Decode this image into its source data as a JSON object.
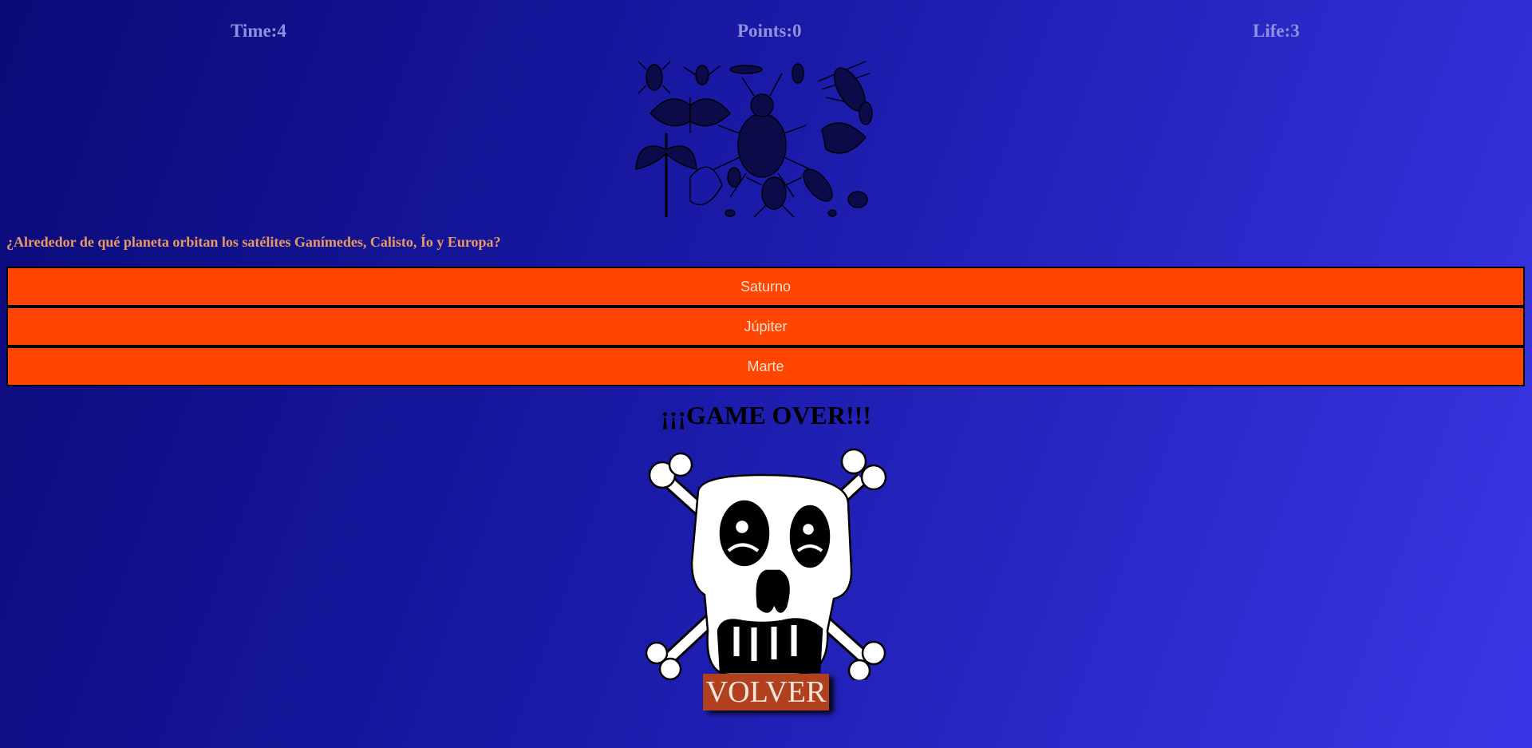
{
  "hud": {
    "time": "Time:4",
    "points": "Points:0",
    "life": "Life:3"
  },
  "question": "¿Alrededor de qué planeta orbitan los satélites Ganímedes, Calisto, Ío y Europa?",
  "answers": [
    {
      "label": "Saturno"
    },
    {
      "label": "Júpiter"
    },
    {
      "label": "Marte"
    }
  ],
  "game_over": "¡¡¡GAME OVER!!!",
  "volver_button": "VOLVER",
  "colors": {
    "answer_bg": "#ff4500",
    "question_text": "#e89a62",
    "hud_text": "#8f92dc",
    "volver_bg": "#b0401e"
  },
  "images": {
    "category_image": "insects-illustration",
    "game_over_image": "skull-crossbones-icon"
  }
}
